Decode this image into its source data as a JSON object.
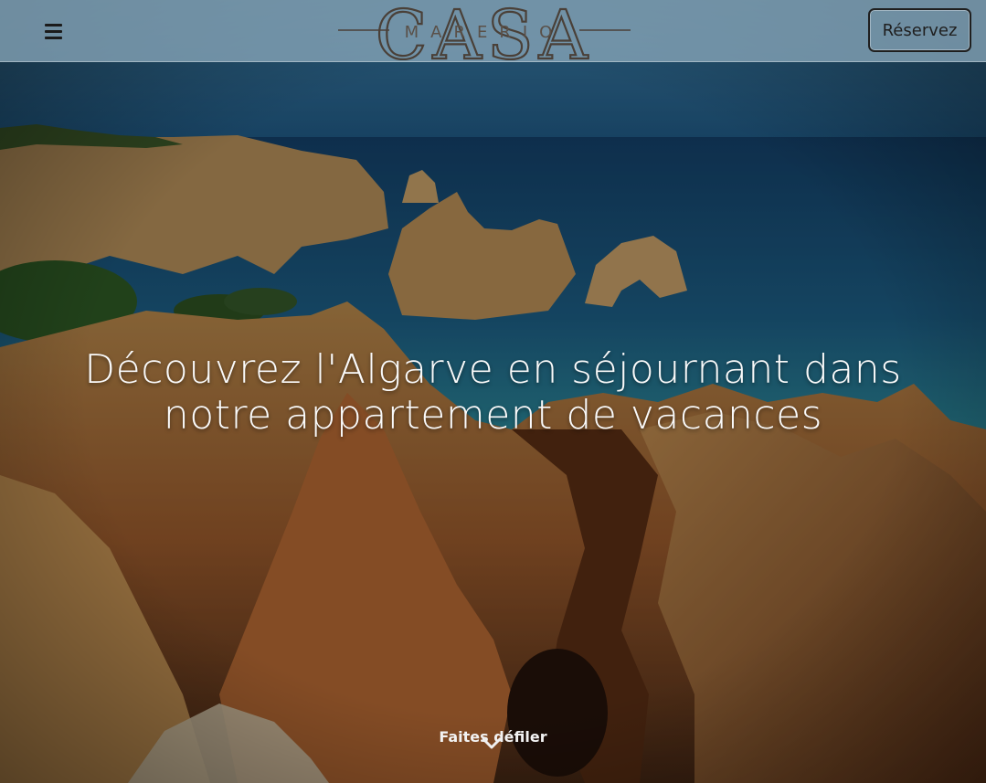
{
  "header": {
    "logo": {
      "main": "CASA",
      "sub": "MARERIO"
    },
    "reserve_label": "Réservez"
  },
  "hero": {
    "title_line1": "Découvrez l'Algarve en séjournant dans",
    "title_line2": "notre appartement de vacances",
    "scroll_label": "Faites défiler"
  },
  "icons": {
    "menu": "hamburger-menu-icon",
    "scroll": "chevron-down-icon"
  },
  "colors": {
    "header_overlay": "#87a5b9",
    "logo": "#4a4038",
    "logo_accent": "#3b66d4",
    "text_light": "#fafafa"
  }
}
